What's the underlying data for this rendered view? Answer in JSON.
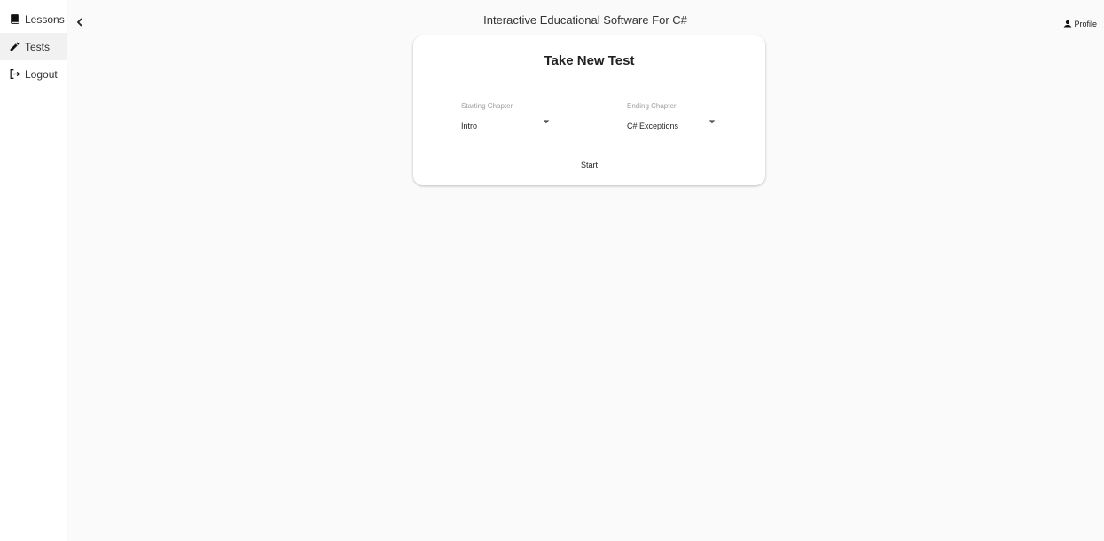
{
  "app": {
    "title": "Interactive Educational Software For C#"
  },
  "sidebar": {
    "items": [
      {
        "label": "Lessons",
        "icon": "book-icon"
      },
      {
        "label": "Tests",
        "icon": "pencil-icon"
      },
      {
        "label": "Logout",
        "icon": "logout-icon"
      }
    ],
    "active_index": 1
  },
  "header": {
    "profile_label": "Profile",
    "collapse_icon": "chevron-left-icon"
  },
  "test_card": {
    "title": "Take New Test",
    "starting_chapter": {
      "label": "Starting Chapter",
      "value": "Intro"
    },
    "ending_chapter": {
      "label": "Ending Chapter",
      "value": "C# Exceptions"
    },
    "start_label": "Start"
  },
  "colors": {
    "background": "#fafafa",
    "sidebar_active": "#f1f1f1",
    "card": "#ffffff"
  }
}
